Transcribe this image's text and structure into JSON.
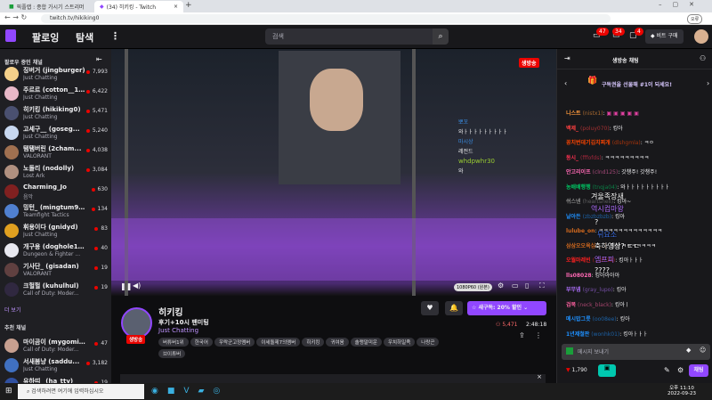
{
  "browser": {
    "tabs": [
      {
        "label": "픽플랩 : 종합 가시기 스트리머"
      },
      {
        "label": "(34) 히키킹 - Twitch"
      }
    ],
    "url": "twitch.tv/hikiking0",
    "profile_label": "오류"
  },
  "nav": {
    "following": "팔로잉",
    "browse": "탐색",
    "search_placeholder": "검색",
    "badges": [
      "47",
      "34",
      "4"
    ],
    "bits_label": "비트 구매"
  },
  "sidebar": {
    "followed_header": "팔로우 중인 채널",
    "more": "더 보기",
    "recommended_header": "추천 채널",
    "followed": [
      {
        "name": "징버거 (jingburger)",
        "game": "Just Chatting",
        "viewers": "7,993",
        "color": "#f5d08a"
      },
      {
        "name": "주르르 (cotton__1...",
        "game": "Just Chatting",
        "viewers": "6,422",
        "color": "#e8b8c8"
      },
      {
        "name": "히키킹 (hikiking0)",
        "game": "Just Chatting",
        "viewers": "5,471",
        "color": "#4a5070"
      },
      {
        "name": "고세구__ (goseg...",
        "game": "Just Chatting",
        "viewers": "5,240",
        "color": "#c8d8f0"
      },
      {
        "name": "탬탬버린 (2cham...",
        "game": "VALORANT",
        "viewers": "4,038",
        "color": "#a07050"
      },
      {
        "name": "노돌리 (nodolly)",
        "game": "Lost Ark",
        "viewers": "3,084",
        "color": "#b09080"
      },
      {
        "name": "Charming_Jo",
        "game": "음악",
        "viewers": "630",
        "color": "#802020"
      },
      {
        "name": "밍턴_ (mingtum97)",
        "game": "Teamfight Tactics",
        "viewers": "134",
        "color": "#5080d0"
      },
      {
        "name": "휘용이다 (gnidyd)",
        "game": "Just Chatting",
        "viewers": "83",
        "color": "#e0a020"
      },
      {
        "name": "개구용 (doghole19...",
        "game": "Dungeon & Fighter ...",
        "viewers": "40",
        "color": "#e8e8f0"
      },
      {
        "name": "기사단_ (gisadan)",
        "game": "VALORANT",
        "viewers": "19",
        "color": "#604040"
      },
      {
        "name": "크헐헐 (kuhulhul)",
        "game": "Call of Duty: Moder...",
        "viewers": "19",
        "color": "#302840"
      }
    ],
    "recommended": [
      {
        "name": "마이곰이 (mygomi...",
        "game": "Call of Duty: Moder...",
        "viewers": "47",
        "color": "#c8a090"
      },
      {
        "name": "서새봄냥 (saddu...",
        "game": "Just Chatting",
        "viewers": "3,182",
        "color": "#4070c0"
      },
      {
        "name": "유하띠_ (ha_tty)",
        "game": "",
        "viewers": "19",
        "color": "#3050a0"
      }
    ]
  },
  "video": {
    "live_badge": "생방송",
    "quality": "1080P60 (원본)",
    "overlay_chat": [
      {
        "user": "뽀꼬",
        "text": "와ㅏㅏㅏㅏㅏㅏㅏㅏㅏ",
        "color": "#3a8ee6"
      },
      {
        "user": "마시상",
        "text": "레전드",
        "color": "#3a8ee6"
      },
      {
        "user": "whdpwhr30",
        "text": "와",
        "color": "#9acd32"
      }
    ]
  },
  "stream": {
    "channel": "히키킹",
    "title": "후기+10시 팬미팅",
    "category": "Just Chatting",
    "live_label": "생방송",
    "subscribe_label": "새구독: 20% 할인",
    "viewers": "5,471",
    "uptime": "2:48:18",
    "tags": [
      "버튜버1위",
      "한국어",
      "우락군고정멤버",
      "이세돌제7의멤버",
      "히키킹",
      "귀여움",
      "솔랭말미운",
      "우치하일족",
      "나랑곤",
      "브이튜버"
    ]
  },
  "chat": {
    "title": "생방송 채팅",
    "promo": "구독권을 선물해 #1이 되세요!",
    "input_placeholder": "메시지 보내기",
    "points": "1,790",
    "chat_button": "채팅",
    "messages": [
      {
        "user": "니스트",
        "id": "(nistx1)",
        "text": "",
        "color": "#ff9a3c"
      },
      {
        "user": "백제_",
        "id": "(poluy070)",
        "text": "킹아",
        "color": "#ff4040"
      },
      {
        "user": "꽁치번데기김치찌개",
        "id": "(dlshgmla)",
        "text": "ㅋㅇ",
        "color": "#ff4500"
      },
      {
        "user": "동시_",
        "id": "(fffofds)",
        "text": "ㅋㅋㅋㅋㅋㅋㅋㅋㅋ",
        "color": "#ff3050"
      },
      {
        "user": "안고리이프",
        "id": "(clnd125)",
        "text": "갓챙주! 갓챙주!",
        "color": "#ff69b4"
      },
      {
        "user": "농배배행행",
        "id": "(tnqja04)",
        "text": "와ㅏㅏㅏㅏㅏㅏㅏㅏㅏ",
        "color": "#00c060"
      },
      {
        "user": "쉬스넨",
        "id": "(heartshell)",
        "text": "킹아~",
        "color": "#8a8a8a"
      },
      {
        "user": "날아든",
        "id": "(zbzbzbzb)",
        "text": "킹아",
        "color": "#1e90ff"
      },
      {
        "user": "lulube_on",
        "id": "",
        "text": "ㅋㅋㅋㅋㅋㅋㅋㅋㅋㅋㅋㅋㅋ",
        "color": "#d2691e"
      },
      {
        "user": "삼삼오오욕심",
        "id": "(...)",
        "text": "킹아 ㅋㅋㅋㅋㅋㅋㅋ",
        "color": "#d2691e"
      },
      {
        "user": "오월마레빈",
        "id": "(...d113)",
        "text": "킹아ㅏㅏㅏ",
        "color": "#ff2020"
      },
      {
        "user": "lls08028",
        "id": "",
        "text": "킹아아아아",
        "color": "#ff69b4"
      },
      {
        "user": "부무넴",
        "id": "(gray_lupo)",
        "text": "킹아",
        "color": "#b070ff"
      },
      {
        "user": "검복",
        "id": "(neck_black)",
        "text": "킹아ㅣ",
        "color": "#ff60a0"
      },
      {
        "user": "메시밥그릇",
        "id": "(oo08ee)",
        "text": "킹아",
        "color": "#1e90ff"
      },
      {
        "user": "1년제철판",
        "id": "(wonhk01)",
        "text": "킹아ㅏㅏㅏ",
        "color": "#1e90ff"
      }
    ],
    "floating": [
      "겨울족장새",
      "역시컴마왕",
      "?",
      "뒤요소",
      "축하영상? ㄷㄷ",
      "엠프피",
      "????"
    ]
  },
  "taskbar": {
    "search_placeholder": "검색하려면 여기에 입력하십시오",
    "time": "오후 11:10",
    "date": "2022-09-23"
  },
  "colors": {
    "accent": "#9147ff",
    "live": "#eb0400"
  }
}
